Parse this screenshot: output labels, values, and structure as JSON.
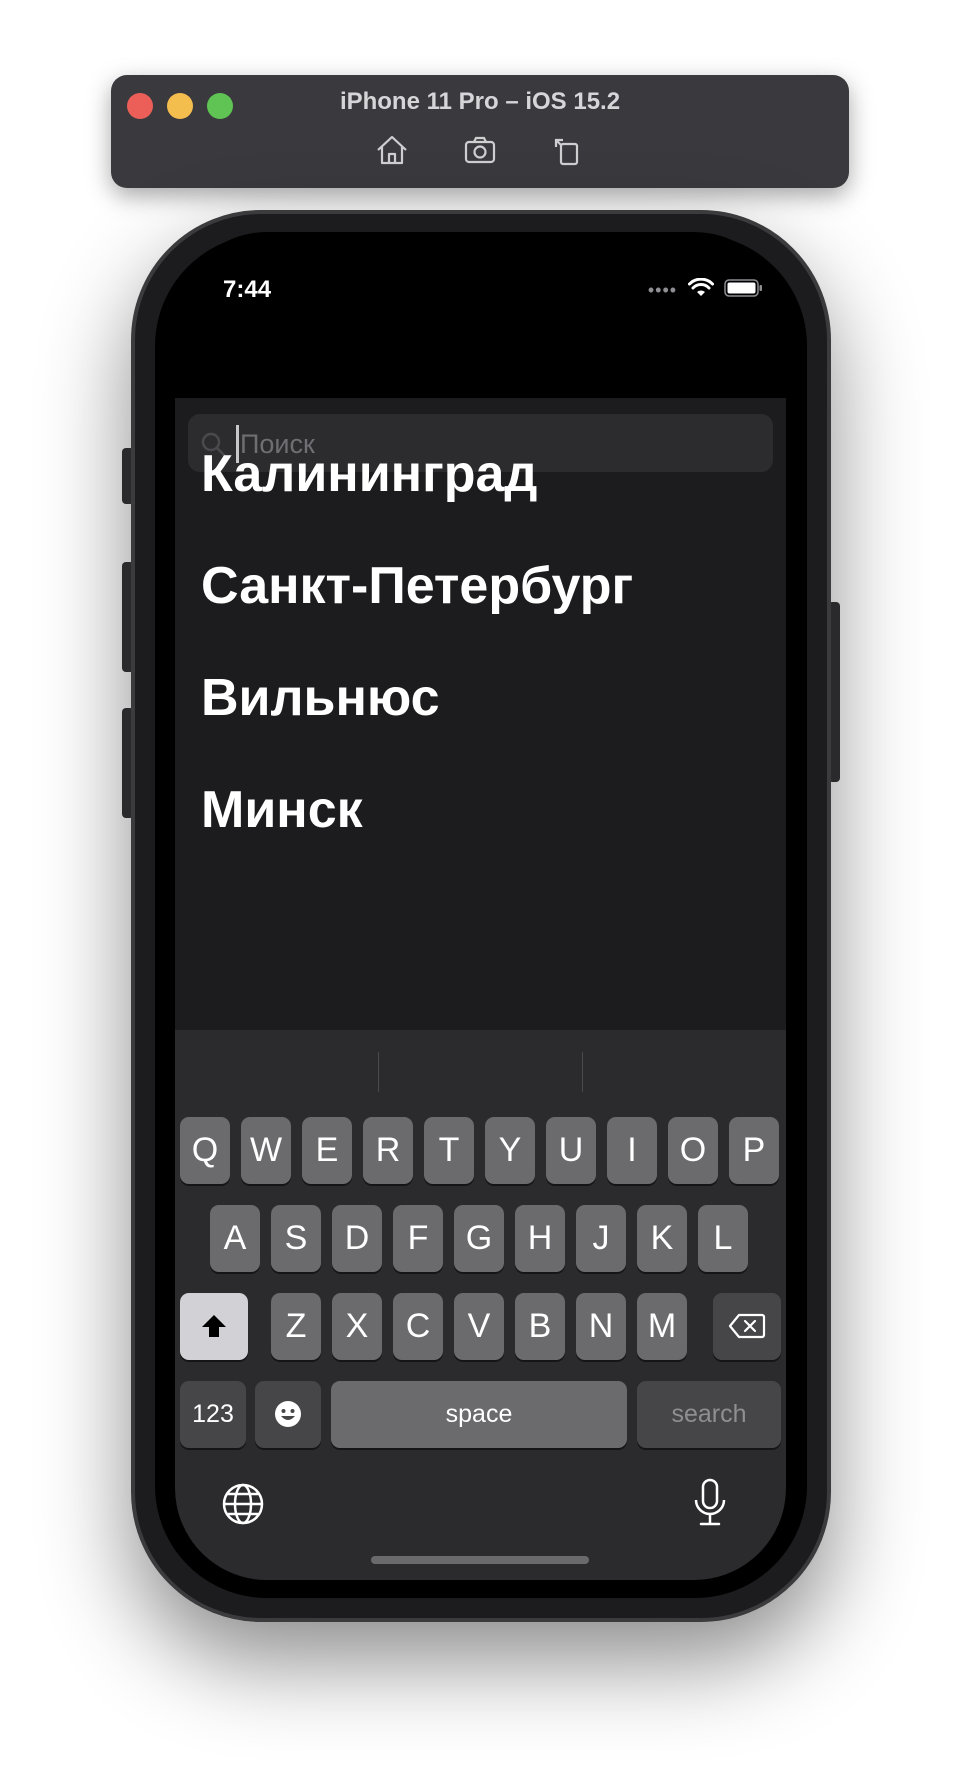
{
  "simulator": {
    "title": "iPhone 11 Pro – iOS 15.2",
    "tools": [
      "home-icon",
      "screenshot-icon",
      "rotate-icon"
    ]
  },
  "status_bar": {
    "time": "7:44",
    "icons": [
      "signal-dots-icon",
      "wifi-icon",
      "battery-icon"
    ]
  },
  "search": {
    "placeholder": "Поиск",
    "value": ""
  },
  "cities": [
    "Калининград",
    "Санкт-Петербург",
    "Вильнюс",
    "Минск"
  ],
  "keyboard": {
    "row1": [
      "Q",
      "W",
      "E",
      "R",
      "T",
      "Y",
      "U",
      "I",
      "O",
      "P"
    ],
    "row2": [
      "A",
      "S",
      "D",
      "F",
      "G",
      "H",
      "J",
      "K",
      "L"
    ],
    "row3": [
      "Z",
      "X",
      "C",
      "V",
      "B",
      "N",
      "M"
    ],
    "numbers_label": "123",
    "space_label": "space",
    "search_label": "search",
    "icons": [
      "shift-icon",
      "delete-icon",
      "emoji-icon",
      "globe-icon",
      "microphone-icon"
    ]
  },
  "colors": {
    "background": "#1c1c1e",
    "keyboard": "#2b2b2d",
    "key": "#6b6b6d",
    "text": "#ffffff"
  }
}
